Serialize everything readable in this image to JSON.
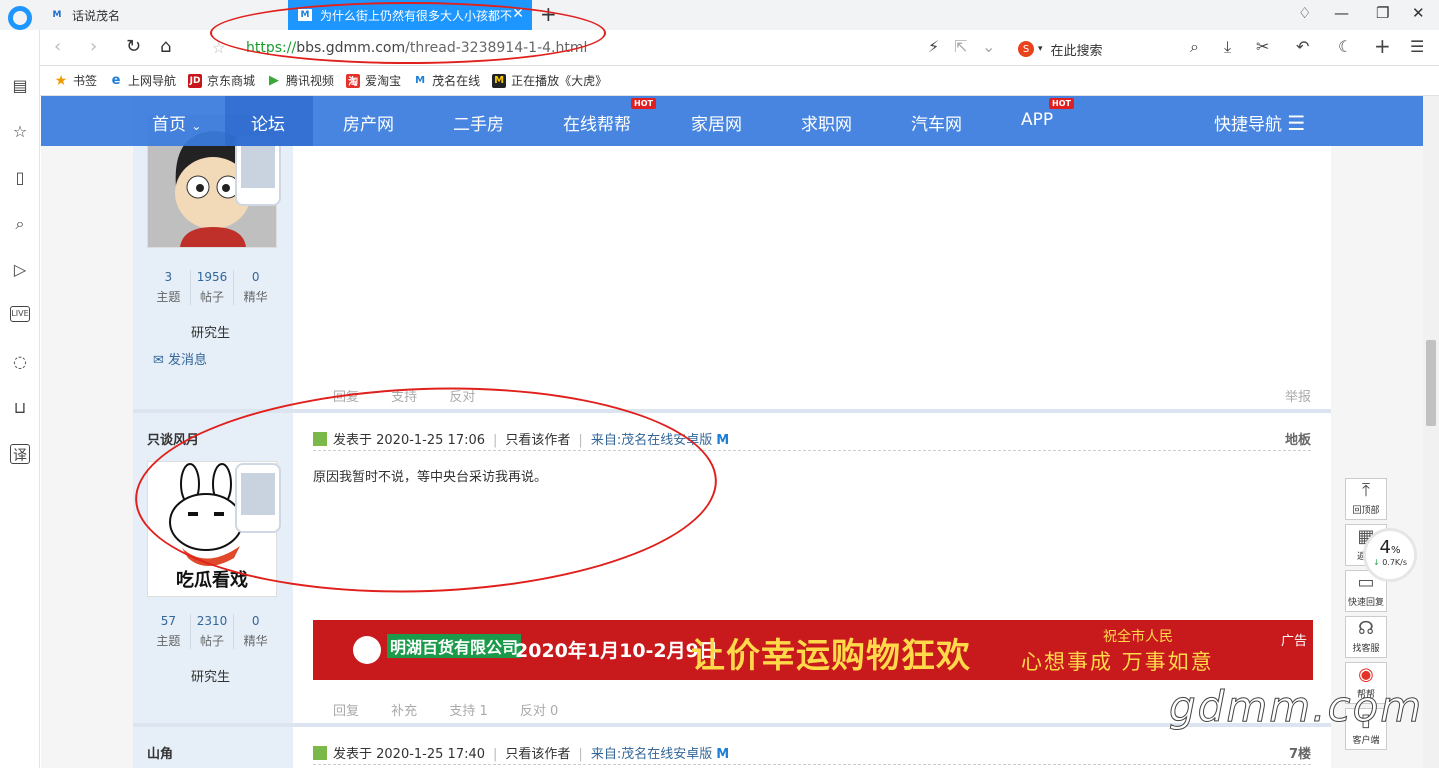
{
  "browser": {
    "tabs": [
      {
        "title": "话说茂名",
        "active": false
      },
      {
        "title": "为什么街上仍然有很多大人小孩都不",
        "active": true
      }
    ],
    "address": {
      "protocol": "https://",
      "host": "bbs.gdmm.com",
      "path": "/thread-3238914-1-4.html"
    },
    "search_placeholder": "在此搜索",
    "bookmarks": [
      {
        "label": "书签",
        "icon": "star-icon"
      },
      {
        "label": "上网导航",
        "icon": "ie-icon"
      },
      {
        "label": "京东商城",
        "icon": "jd-icon"
      },
      {
        "label": "腾讯视频",
        "icon": "play-icon"
      },
      {
        "label": "爱淘宝",
        "icon": "taobao-icon"
      },
      {
        "label": "茂名在线",
        "icon": "m-icon"
      },
      {
        "label": "正在播放《大虎》",
        "icon": "m-yellow-icon"
      }
    ]
  },
  "site_nav": {
    "items": [
      "首页",
      "论坛",
      "房产网",
      "二手房",
      "在线帮帮",
      "家居网",
      "求职网",
      "汽车网",
      "APP"
    ],
    "hot_badge": "HOT",
    "quick_nav": "快捷导航"
  },
  "posts": [
    {
      "author": "",
      "stats": [
        {
          "n": "3",
          "label": "主题"
        },
        {
          "n": "1956",
          "label": "帖子"
        },
        {
          "n": "0",
          "label": "精华"
        }
      ],
      "rank": "研究生",
      "send_message": "发消息",
      "actions": [
        "回复",
        "支持",
        "反对"
      ],
      "report": "举报"
    },
    {
      "author": "只谈风月",
      "posted": "发表于 2020-1-25 17:06",
      "only_author": "只看该作者",
      "source": "来自:茂名在线安卓版",
      "floor": "地板",
      "body": "原因我暂时不说，等中央台采访我再说。",
      "avatar_caption": "吃瓜看戏",
      "stats": [
        {
          "n": "57",
          "label": "主题"
        },
        {
          "n": "2310",
          "label": "帖子"
        },
        {
          "n": "0",
          "label": "精华"
        }
      ],
      "rank": "研究生",
      "actions": [
        "回复",
        "补充",
        "支持 1",
        "反对 0"
      ]
    },
    {
      "author": "山角",
      "posted": "发表于 2020-1-25 17:40",
      "only_author": "只看该作者",
      "source": "来自:茂名在线安卓版",
      "floor": "7楼"
    }
  ],
  "ad": {
    "company": "明湖百货有限公司",
    "date": "2020年1月10-2月9日",
    "headline": "让价幸运购物狂欢",
    "sub1": "祝全市人民",
    "sub2": "心想事成 万事如意",
    "tag": "广告"
  },
  "float_bar": [
    "回顶部",
    "返回",
    "快速回复",
    "找客服",
    "帮帮",
    "客户端"
  ],
  "speed": {
    "percent": "4",
    "unit": "%",
    "rate": "0.7K/s"
  },
  "watermark": "gdmm.com"
}
